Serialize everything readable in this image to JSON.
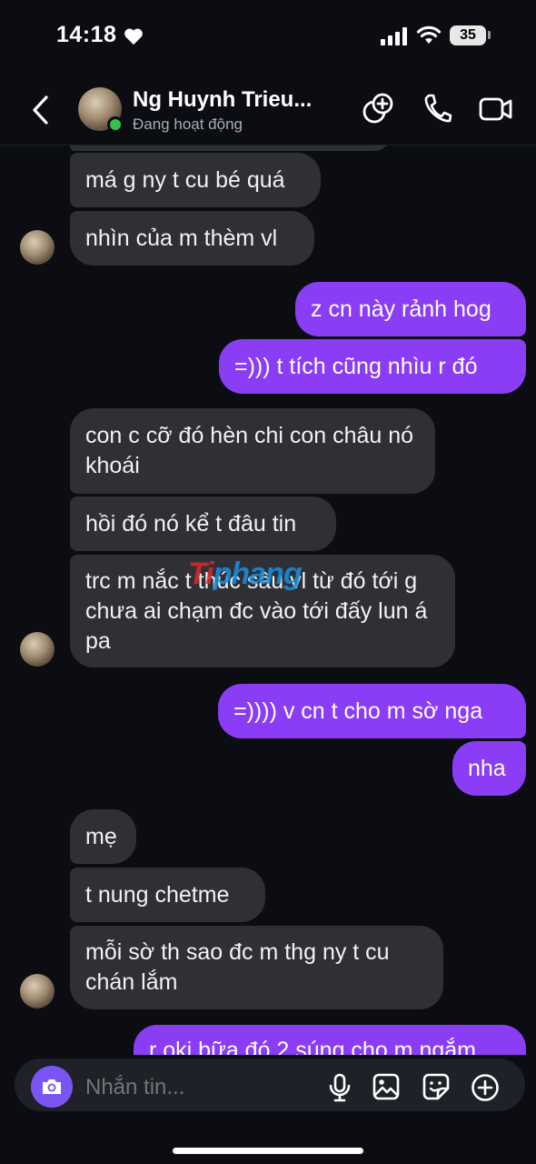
{
  "status_bar": {
    "time": "14:18",
    "battery": "35"
  },
  "header": {
    "name": "Ng Huynh Trieu...",
    "status": "Đang hoạt động"
  },
  "messages": [
    {
      "text": "má g ny t cu bé quá"
    },
    {
      "text": "nhìn của m thèm vl"
    },
    {
      "text": "z cn này rảnh hog"
    },
    {
      "text": "=))) t tích cũng nhìu r đó"
    },
    {
      "text": "con c cỡ đó hèn chi con châu nó khoái"
    },
    {
      "text": "hồi đó nó kể t đâu tin"
    },
    {
      "text": "trc m nắc t thúc sâu vl từ đó tới g chưa ai chạm đc vào tới đấy lun á pa"
    },
    {
      "text": "=)))) v cn t cho m sờ nga"
    },
    {
      "text": "nha"
    },
    {
      "text": "mẹ"
    },
    {
      "text": "t nung chetme"
    },
    {
      "text": "mỗi sờ th sao đc m thg ny t cu chán lắm"
    },
    {
      "text": "r oki bữa đó 2 súng cho m ngắm"
    }
  ],
  "watermark": {
    "part1": "Ti",
    "part2": "phang"
  },
  "composer": {
    "placeholder": "Nhắn tin..."
  },
  "colors": {
    "outgoing": "#8a3df5",
    "incoming": "#2e3036",
    "background": "#0b0d12",
    "online": "#31c24d",
    "camera": "#7b55f2"
  },
  "icons": [
    "heart-icon",
    "signal-icon",
    "wifi-icon",
    "back-icon",
    "add-people-icon",
    "phone-icon",
    "video-icon",
    "camera-icon",
    "microphone-icon",
    "gallery-icon",
    "sticker-icon",
    "plus-icon"
  ]
}
